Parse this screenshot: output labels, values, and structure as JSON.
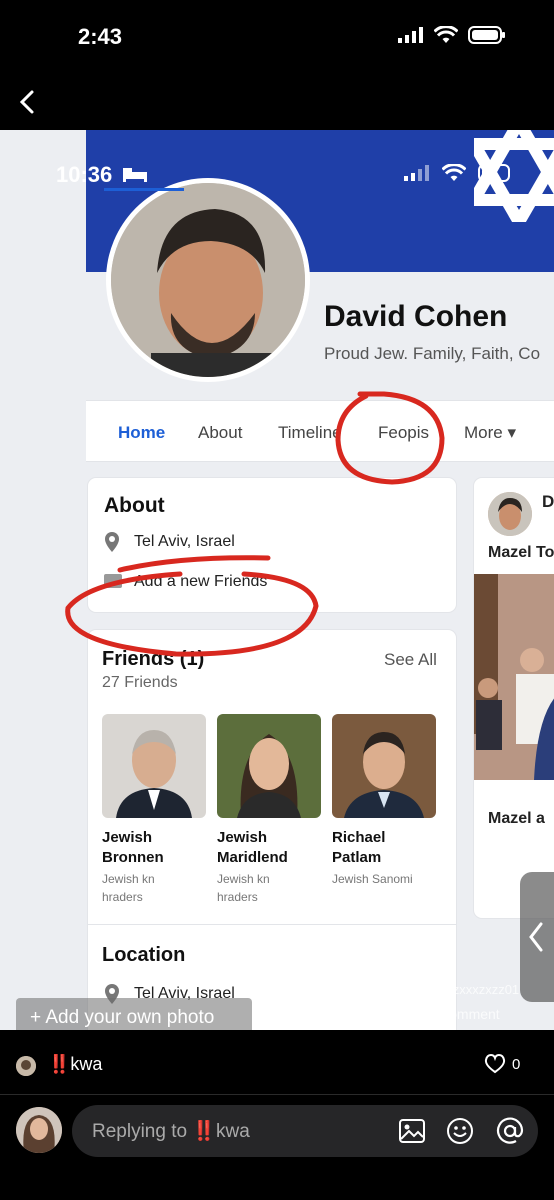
{
  "status_bar": {
    "time": "2:43"
  },
  "media": {
    "inner_status": {
      "time": "10:36"
    },
    "profile": {
      "name": "David Cohen",
      "bio": "Proud Jew. Family, Faith, Co"
    },
    "tabs": [
      {
        "label": "Home",
        "active": true
      },
      {
        "label": "About",
        "active": false
      },
      {
        "label": "Timeline",
        "active": false
      },
      {
        "label": "Feopis",
        "active": false
      },
      {
        "label": "More ▾",
        "active": false
      }
    ],
    "about": {
      "title": "About",
      "location": "Tel Aviv, Israel",
      "add_friends": "Add a new Friends"
    },
    "friends": {
      "title": "Friends (1)",
      "see_all": "See All",
      "count": "27 Friends",
      "items": [
        {
          "name_line1": "Jewish",
          "name_line2": "Bronnen",
          "sub_line1": "Jewish kn",
          "sub_line2": "hraders"
        },
        {
          "name_line1": "Jewish",
          "name_line2": "Maridlend",
          "sub_line1": "Jewish kn",
          "sub_line2": "hraders"
        },
        {
          "name_line1": "Richael",
          "name_line2": "Patlam",
          "sub_line1": "Jewish Sanomi",
          "sub_line2": ""
        }
      ]
    },
    "location": {
      "title": "Location",
      "value": "Tel Aviv, Israel"
    },
    "right_col": {
      "initial": "D",
      "post_caption": "Mazel To",
      "post_caption2": "Mazel a"
    },
    "add_photo_label": "+ Add your own photo",
    "watermark_user": "@zzzzxxxzxzz01",
    "watermark_from": "From  TikTok  comment"
  },
  "reply_meta": {
    "author": "‼️kwa",
    "likes": "0"
  },
  "composer": {
    "placeholder": "Replying to ‼️kwa"
  },
  "colors": {
    "cover_blue": "#1f3fa8",
    "tab_active": "#1d5fd6",
    "annotation_red": "#d8281f"
  }
}
